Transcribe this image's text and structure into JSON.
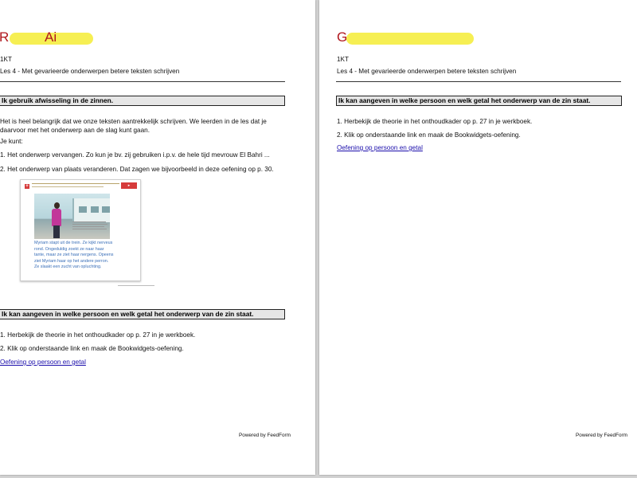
{
  "pages": [
    {
      "title_initial": "R",
      "title_rest": "Ai",
      "class_label": "1KT",
      "lesson_label": "Les 4 - Met gevarieerde onderwerpen betere teksten schrijven",
      "sections": [
        {
          "heading": "Ik gebruik afwisseling in de zinnen.",
          "intro": "Het is heel belangrijk dat we onze teksten aantrekkelijk schrijven. We leerden in de les dat je daarvoor met het onderwerp aan de slag kunt gaan.",
          "je_kunt": "Je kunt:",
          "items": [
            "1. Het onderwerp vervangen. Zo kun je bv. zij gebruiken i.p.v. de hele tijd mevrouw El Bahri ...",
            "2. Het onderwerp van plaats veranderen. Dat zagen we bijvoorbeeld in deze oefening op p. 30."
          ]
        },
        {
          "heading": "Ik kan aangeven in welke persoon en welk getal het onderwerp van de zin staat.",
          "items": [
            "1. Herbekijk de theorie in het onthoudkader op p. 27 in je werkboek.",
            "2. Klik op onderstaande link en maak de Bookwidgets-oefening."
          ],
          "link": "Oefening op persoon en getal"
        }
      ],
      "workbook_image": {
        "blue_text": "Myriam stapt uit de trein. Ze kijkt nerveus rond. Ongeduldig zoekt ze naar haar tante, maar ze ziet haar nergens. Opeens ziet Myriam haar op het andere perron. Ze slaakt een zucht van opluchting."
      },
      "footer": "Powered by FeedForm"
    },
    {
      "title_initial": "G",
      "title_rest": "",
      "class_label": "1KT",
      "lesson_label": "Les 4 - Met gevarieerde onderwerpen betere teksten schrijven",
      "sections": [
        {
          "heading": "Ik kan aangeven in welke persoon en welk getal het onderwerp van de zin staat.",
          "items": [
            "1. Herbekijk de theorie in het onthoudkader op p. 27 in je werkboek.",
            "2. Klik op onderstaande link en maak de Bookwidgets-oefening."
          ],
          "link": "Oefening op persoon en getal"
        }
      ],
      "footer": "Powered by FeedForm"
    }
  ],
  "colors": {
    "title_red": "#b0181e",
    "highlight_yellow": "#f5ee4a",
    "link_blue": "#1a0dab",
    "section_bg": "#e6e6e6"
  }
}
